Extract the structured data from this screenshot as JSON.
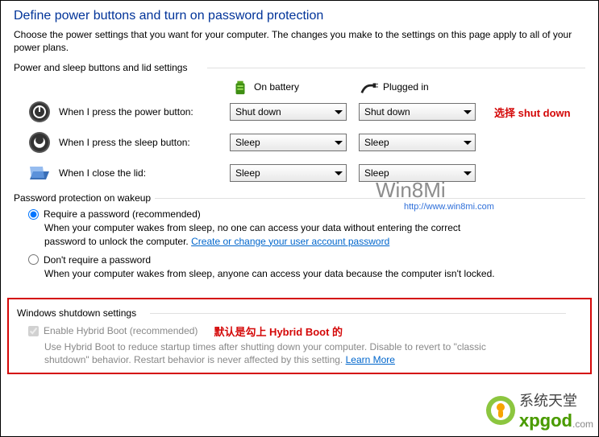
{
  "title": "Define power buttons and turn on password protection",
  "description": "Choose the power settings that you want for your computer. The changes you make to the settings on this page apply to all of your power plans.",
  "sections": {
    "buttons_label": "Power and sleep buttons and lid settings",
    "password_label": "Password protection on wakeup",
    "shutdown_label": "Windows shutdown settings"
  },
  "col_headers": {
    "battery": "On battery",
    "plugged": "Plugged in"
  },
  "rows": {
    "power_btn": {
      "label": "When I press the power button:",
      "battery": "Shut down",
      "plugged": "Shut down",
      "annotation": "选择 shut down"
    },
    "sleep_btn": {
      "label": "When I press the sleep button:",
      "battery": "Sleep",
      "plugged": "Sleep"
    },
    "lid": {
      "label": "When I close the lid:",
      "battery": "Sleep",
      "plugged": "Sleep"
    }
  },
  "pwd": {
    "require_label": "Require a password (recommended)",
    "require_desc": "When your computer wakes from sleep, no one can access your data without entering the correct password to unlock the computer.",
    "require_link": "Create or change your user account password",
    "no_label": "Don't require a password",
    "no_desc": "When your computer wakes from sleep, anyone can access your data because the computer isn't locked."
  },
  "hybrid": {
    "chk_label": "Enable Hybrid Boot (recommended)",
    "annotation": "默认是勾上 Hybrid Boot 的",
    "desc": "Use Hybrid Boot to reduce startup times after shutting down your computer. Disable to revert to \"classic shutdown\" behavior. Restart behavior is never affected by this setting.",
    "link": "Learn More"
  },
  "watermark": {
    "brand": "Win8Mi",
    "url": "http://www.win8mi.com"
  },
  "logo": {
    "cn": "系统天堂",
    "en": "xpgod",
    "tld": ".com"
  }
}
